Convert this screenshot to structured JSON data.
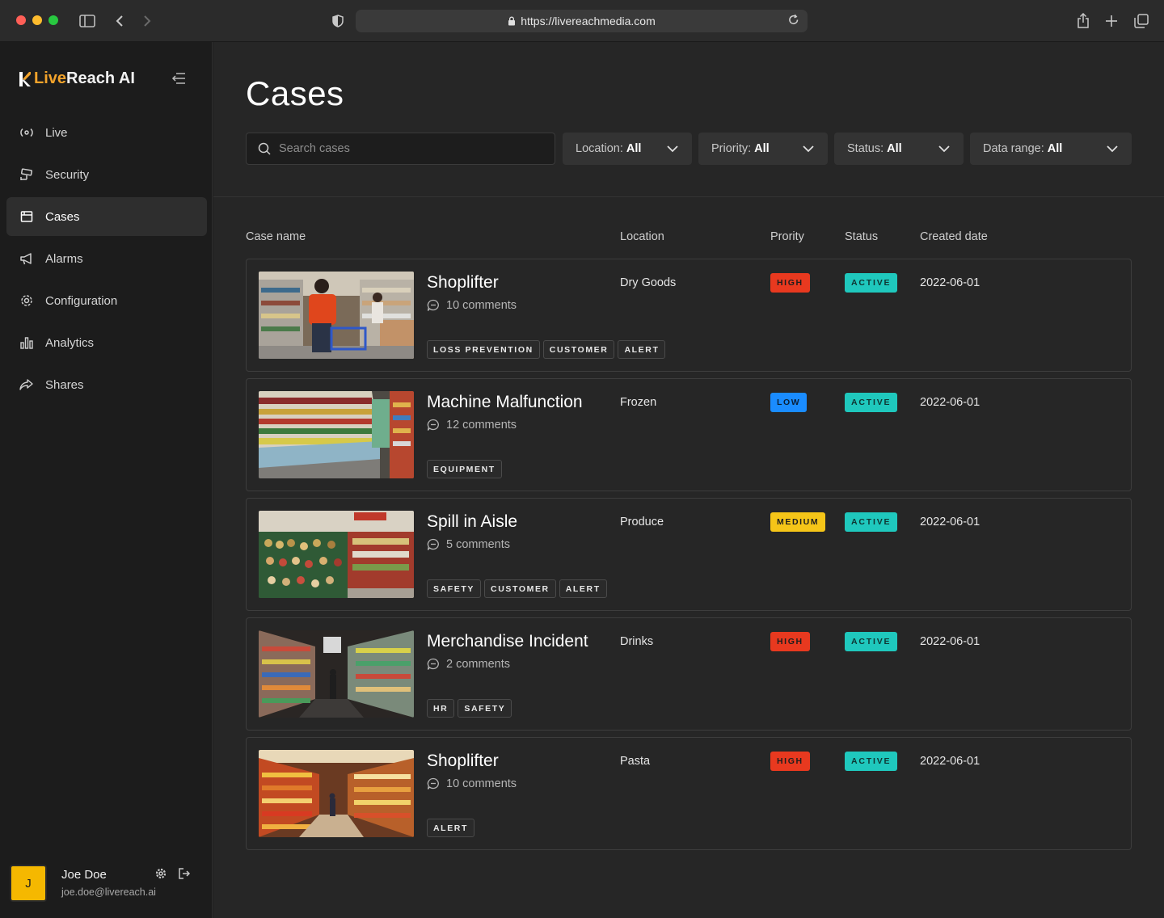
{
  "browser": {
    "url": "https://livereachmedia.com"
  },
  "brand": {
    "prefix": "Live",
    "suffix": "Reach AI"
  },
  "nav": [
    {
      "label": "Live",
      "icon": "live-icon"
    },
    {
      "label": "Security",
      "icon": "cctv-icon"
    },
    {
      "label": "Cases",
      "icon": "folder-icon",
      "active": true
    },
    {
      "label": "Alarms",
      "icon": "megaphone-icon"
    },
    {
      "label": "Configuration",
      "icon": "gear-icon"
    },
    {
      "label": "Analytics",
      "icon": "bar-chart-icon"
    },
    {
      "label": "Shares",
      "icon": "share-icon"
    }
  ],
  "user": {
    "initial": "J",
    "name": "Joe Doe",
    "email": "joe.doe@livereach.ai"
  },
  "page": {
    "title": "Cases"
  },
  "search": {
    "placeholder": "Search cases"
  },
  "filters": [
    {
      "label": "Location:",
      "value": "All"
    },
    {
      "label": "Priority:",
      "value": "All"
    },
    {
      "label": "Status:",
      "value": "All"
    },
    {
      "label": "Data range:",
      "value": "All"
    }
  ],
  "table": {
    "headers": {
      "name": "Case name",
      "location": "Location",
      "priority": "Prority",
      "status": "Status",
      "created": "Created date"
    },
    "rows": [
      {
        "name": "Shoplifter",
        "comments": "10 comments",
        "tags": [
          "LOSS PREVENTION",
          "CUSTOMER",
          "ALERT"
        ],
        "location": "Dry Goods",
        "priority": "HIGH",
        "status": "ACTIVE",
        "date": "2022-06-01"
      },
      {
        "name": "Machine Malfunction",
        "comments": "12 comments",
        "tags": [
          "EQUIPMENT"
        ],
        "location": "Frozen",
        "priority": "LOW",
        "status": "ACTIVE",
        "date": "2022-06-01"
      },
      {
        "name": "Spill in Aisle",
        "comments": "5 comments",
        "tags": [
          "SAFETY",
          "CUSTOMER",
          "ALERT"
        ],
        "location": "Produce",
        "priority": "MEDIUM",
        "status": "ACTIVE",
        "date": "2022-06-01"
      },
      {
        "name": "Merchandise Incident",
        "comments": "2 comments",
        "tags": [
          "HR",
          "SAFETY"
        ],
        "location": "Drinks",
        "priority": "HIGH",
        "status": "ACTIVE",
        "date": "2022-06-01"
      },
      {
        "name": "Shoplifter",
        "comments": "10 comments",
        "tags": [
          "ALERT"
        ],
        "location": "Pasta",
        "priority": "HIGH",
        "status": "ACTIVE",
        "date": "2022-06-01"
      }
    ]
  },
  "colors": {
    "brand_accent": "#f3a32b",
    "high": "#e8391f",
    "low": "#1a8cff",
    "medium": "#f5c518",
    "active": "#1fc8bd"
  }
}
